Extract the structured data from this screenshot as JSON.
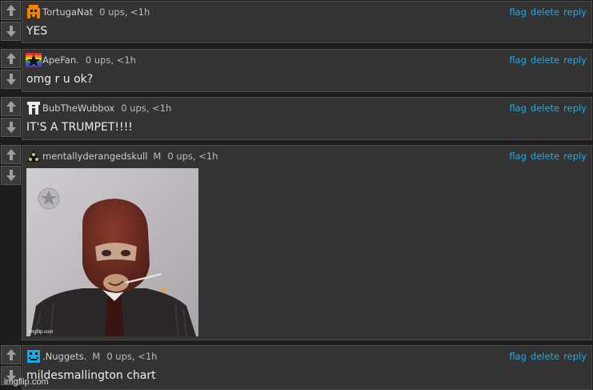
{
  "actions": {
    "flag": "flag",
    "delete": "delete",
    "reply": "reply"
  },
  "comments": [
    {
      "username": "TortugaNat",
      "mod": "",
      "points": "0 ups, <1h",
      "text": "YES"
    },
    {
      "username": "ApeFan.",
      "mod": "",
      "points": "0 ups, <1h",
      "text": "omg r u ok?"
    },
    {
      "username": "BubTheWubbox",
      "mod": "",
      "points": "0 ups, <1h",
      "text": "IT'S A TRUMPET!!!!"
    },
    {
      "username": "mentallyderangedskull",
      "mod": "M",
      "points": "0 ups, <1h",
      "text": "",
      "image": "spy-meme-image",
      "image_watermark": "imgflip.com"
    },
    {
      "username": ".Nuggets.",
      "mod": "M",
      "points": "0 ups, <1h",
      "text": "mildesmallington chart"
    }
  ],
  "page_watermark": "imgflip.com",
  "colors": {
    "background": "#1c1c1c",
    "comment_bg": "#333333",
    "link": "#2aa7e0",
    "text": "#ededed",
    "meta": "#bdbdbd"
  }
}
